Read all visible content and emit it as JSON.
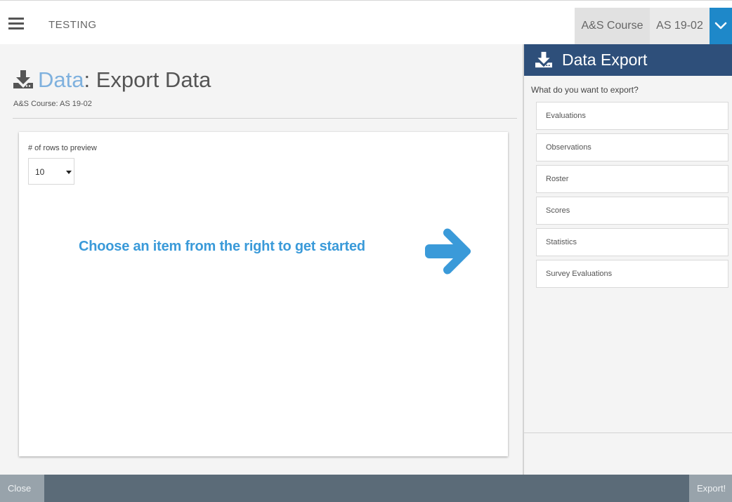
{
  "header": {
    "app_title": "TESTING",
    "course_type": "A&S Course",
    "course_code": "AS 19-02",
    "menu_icon": "hamburger-icon",
    "toggle_icon": "chevron-down-icon"
  },
  "page": {
    "title_section": "Data",
    "title_separator": ":",
    "title_page": " Export Data",
    "subtitle": "A&S Course: AS 19-02",
    "title_icon": "download-icon"
  },
  "preview": {
    "rows_label": "# of rows to preview",
    "rows_value": "10",
    "hint": "Choose an item from the right to get started",
    "hint_icon": "arrow-right-icon"
  },
  "panel": {
    "title": "Data Export",
    "question": "What do you want to export?",
    "items": [
      {
        "label": "Evaluations"
      },
      {
        "label": "Observations"
      },
      {
        "label": "Roster"
      },
      {
        "label": "Scores"
      },
      {
        "label": "Statistics"
      },
      {
        "label": "Survey Evaluations"
      }
    ]
  },
  "footer": {
    "close_label": "Close",
    "export_label": "Export!"
  },
  "colors": {
    "accent_blue": "#1e88c9",
    "panel_header": "#2e4f7a",
    "hint_blue": "#3a9ad9",
    "bottom_bar": "#5b6b78"
  }
}
